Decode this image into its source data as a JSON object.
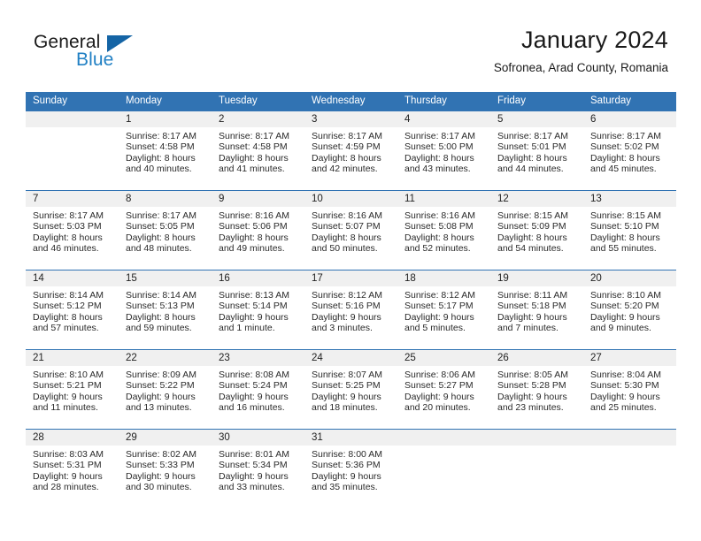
{
  "brand": {
    "name_top": "General",
    "name_bottom": "Blue",
    "accent_color": "#2180c4",
    "triangle_color": "#1464a5"
  },
  "header": {
    "month_title": "January 2024",
    "location": "Sofronea, Arad County, Romania"
  },
  "theme": {
    "header_row_bg": "#3173b3",
    "daynum_bg": "#f0f0f0",
    "separator": "#3173b3"
  },
  "weekday_headers": [
    "Sunday",
    "Monday",
    "Tuesday",
    "Wednesday",
    "Thursday",
    "Friday",
    "Saturday"
  ],
  "weeks": [
    [
      {
        "day": "",
        "lines": []
      },
      {
        "day": "1",
        "lines": [
          "Sunrise: 8:17 AM",
          "Sunset: 4:58 PM",
          "Daylight: 8 hours",
          "and 40 minutes."
        ]
      },
      {
        "day": "2",
        "lines": [
          "Sunrise: 8:17 AM",
          "Sunset: 4:58 PM",
          "Daylight: 8 hours",
          "and 41 minutes."
        ]
      },
      {
        "day": "3",
        "lines": [
          "Sunrise: 8:17 AM",
          "Sunset: 4:59 PM",
          "Daylight: 8 hours",
          "and 42 minutes."
        ]
      },
      {
        "day": "4",
        "lines": [
          "Sunrise: 8:17 AM",
          "Sunset: 5:00 PM",
          "Daylight: 8 hours",
          "and 43 minutes."
        ]
      },
      {
        "day": "5",
        "lines": [
          "Sunrise: 8:17 AM",
          "Sunset: 5:01 PM",
          "Daylight: 8 hours",
          "and 44 minutes."
        ]
      },
      {
        "day": "6",
        "lines": [
          "Sunrise: 8:17 AM",
          "Sunset: 5:02 PM",
          "Daylight: 8 hours",
          "and 45 minutes."
        ]
      }
    ],
    [
      {
        "day": "7",
        "lines": [
          "Sunrise: 8:17 AM",
          "Sunset: 5:03 PM",
          "Daylight: 8 hours",
          "and 46 minutes."
        ]
      },
      {
        "day": "8",
        "lines": [
          "Sunrise: 8:17 AM",
          "Sunset: 5:05 PM",
          "Daylight: 8 hours",
          "and 48 minutes."
        ]
      },
      {
        "day": "9",
        "lines": [
          "Sunrise: 8:16 AM",
          "Sunset: 5:06 PM",
          "Daylight: 8 hours",
          "and 49 minutes."
        ]
      },
      {
        "day": "10",
        "lines": [
          "Sunrise: 8:16 AM",
          "Sunset: 5:07 PM",
          "Daylight: 8 hours",
          "and 50 minutes."
        ]
      },
      {
        "day": "11",
        "lines": [
          "Sunrise: 8:16 AM",
          "Sunset: 5:08 PM",
          "Daylight: 8 hours",
          "and 52 minutes."
        ]
      },
      {
        "day": "12",
        "lines": [
          "Sunrise: 8:15 AM",
          "Sunset: 5:09 PM",
          "Daylight: 8 hours",
          "and 54 minutes."
        ]
      },
      {
        "day": "13",
        "lines": [
          "Sunrise: 8:15 AM",
          "Sunset: 5:10 PM",
          "Daylight: 8 hours",
          "and 55 minutes."
        ]
      }
    ],
    [
      {
        "day": "14",
        "lines": [
          "Sunrise: 8:14 AM",
          "Sunset: 5:12 PM",
          "Daylight: 8 hours",
          "and 57 minutes."
        ]
      },
      {
        "day": "15",
        "lines": [
          "Sunrise: 8:14 AM",
          "Sunset: 5:13 PM",
          "Daylight: 8 hours",
          "and 59 minutes."
        ]
      },
      {
        "day": "16",
        "lines": [
          "Sunrise: 8:13 AM",
          "Sunset: 5:14 PM",
          "Daylight: 9 hours",
          "and 1 minute."
        ]
      },
      {
        "day": "17",
        "lines": [
          "Sunrise: 8:12 AM",
          "Sunset: 5:16 PM",
          "Daylight: 9 hours",
          "and 3 minutes."
        ]
      },
      {
        "day": "18",
        "lines": [
          "Sunrise: 8:12 AM",
          "Sunset: 5:17 PM",
          "Daylight: 9 hours",
          "and 5 minutes."
        ]
      },
      {
        "day": "19",
        "lines": [
          "Sunrise: 8:11 AM",
          "Sunset: 5:18 PM",
          "Daylight: 9 hours",
          "and 7 minutes."
        ]
      },
      {
        "day": "20",
        "lines": [
          "Sunrise: 8:10 AM",
          "Sunset: 5:20 PM",
          "Daylight: 9 hours",
          "and 9 minutes."
        ]
      }
    ],
    [
      {
        "day": "21",
        "lines": [
          "Sunrise: 8:10 AM",
          "Sunset: 5:21 PM",
          "Daylight: 9 hours",
          "and 11 minutes."
        ]
      },
      {
        "day": "22",
        "lines": [
          "Sunrise: 8:09 AM",
          "Sunset: 5:22 PM",
          "Daylight: 9 hours",
          "and 13 minutes."
        ]
      },
      {
        "day": "23",
        "lines": [
          "Sunrise: 8:08 AM",
          "Sunset: 5:24 PM",
          "Daylight: 9 hours",
          "and 16 minutes."
        ]
      },
      {
        "day": "24",
        "lines": [
          "Sunrise: 8:07 AM",
          "Sunset: 5:25 PM",
          "Daylight: 9 hours",
          "and 18 minutes."
        ]
      },
      {
        "day": "25",
        "lines": [
          "Sunrise: 8:06 AM",
          "Sunset: 5:27 PM",
          "Daylight: 9 hours",
          "and 20 minutes."
        ]
      },
      {
        "day": "26",
        "lines": [
          "Sunrise: 8:05 AM",
          "Sunset: 5:28 PM",
          "Daylight: 9 hours",
          "and 23 minutes."
        ]
      },
      {
        "day": "27",
        "lines": [
          "Sunrise: 8:04 AM",
          "Sunset: 5:30 PM",
          "Daylight: 9 hours",
          "and 25 minutes."
        ]
      }
    ],
    [
      {
        "day": "28",
        "lines": [
          "Sunrise: 8:03 AM",
          "Sunset: 5:31 PM",
          "Daylight: 9 hours",
          "and 28 minutes."
        ]
      },
      {
        "day": "29",
        "lines": [
          "Sunrise: 8:02 AM",
          "Sunset: 5:33 PM",
          "Daylight: 9 hours",
          "and 30 minutes."
        ]
      },
      {
        "day": "30",
        "lines": [
          "Sunrise: 8:01 AM",
          "Sunset: 5:34 PM",
          "Daylight: 9 hours",
          "and 33 minutes."
        ]
      },
      {
        "day": "31",
        "lines": [
          "Sunrise: 8:00 AM",
          "Sunset: 5:36 PM",
          "Daylight: 9 hours",
          "and 35 minutes."
        ]
      },
      {
        "day": "",
        "lines": []
      },
      {
        "day": "",
        "lines": []
      },
      {
        "day": "",
        "lines": []
      }
    ]
  ]
}
